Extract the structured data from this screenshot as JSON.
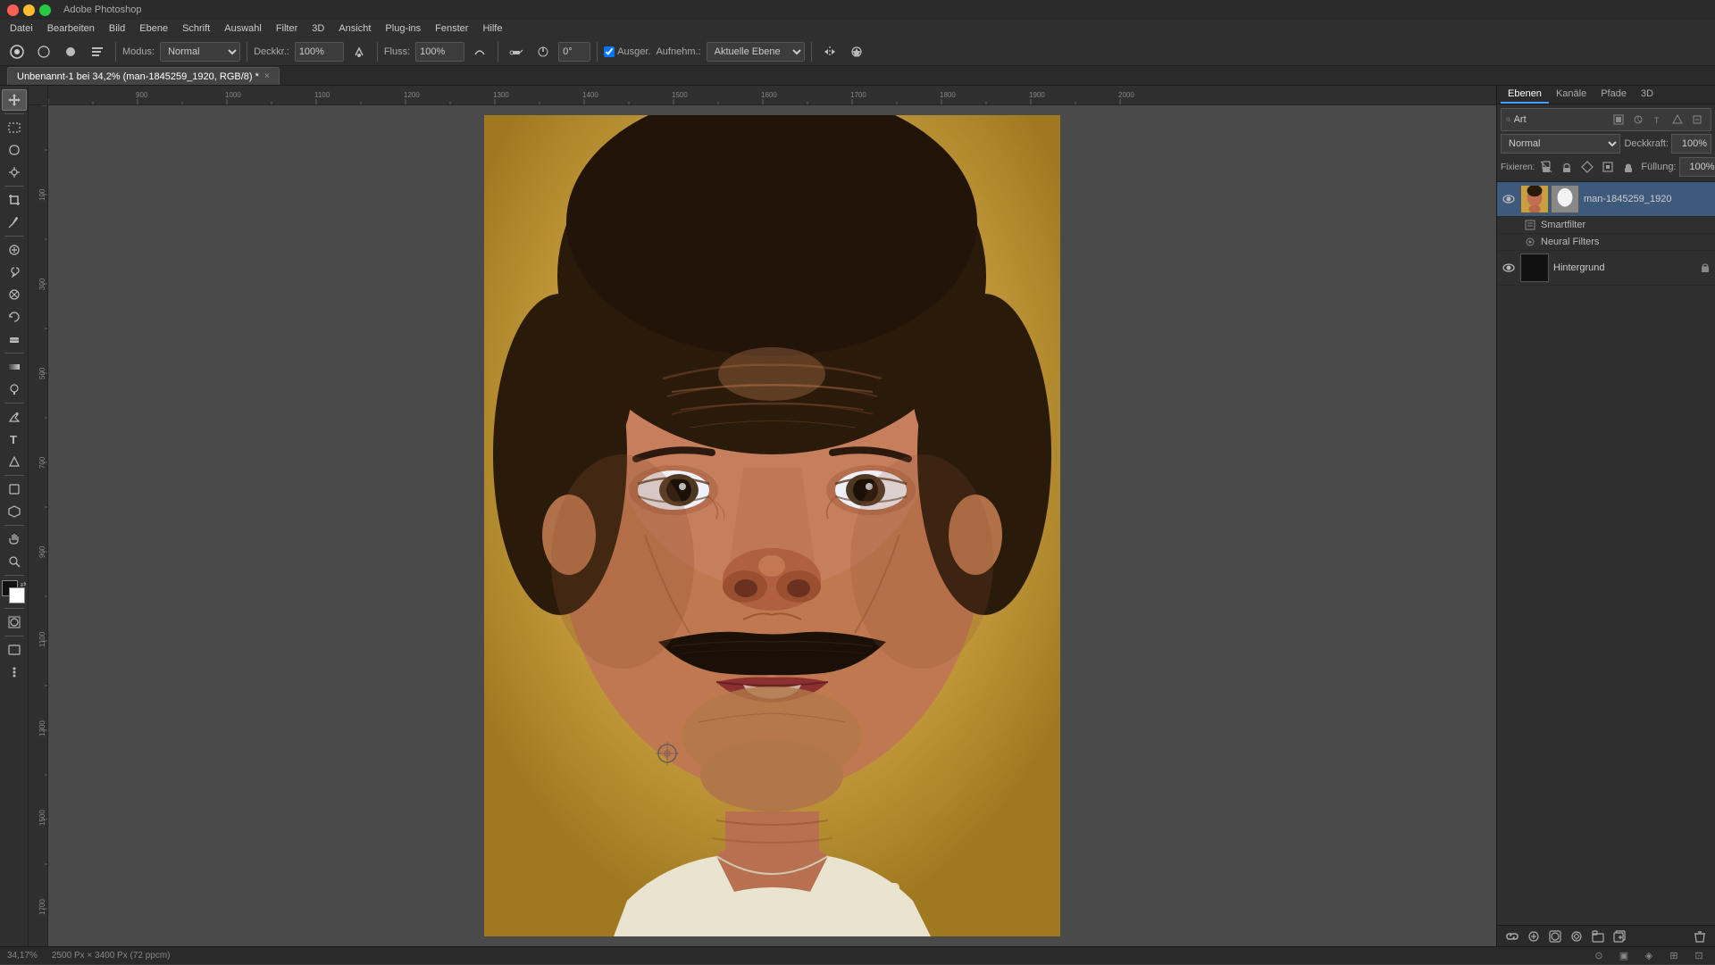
{
  "app": {
    "title": "Adobe Photoshop",
    "window_title": "Unbenannt-1 bei 34,2% (man-1845259_1920, RGB/8) *"
  },
  "titlebar": {
    "close_label": "×",
    "minimize_label": "−",
    "maximize_label": "□"
  },
  "menubar": {
    "items": [
      "Datei",
      "Bearbeiten",
      "Bild",
      "Ebene",
      "Schrift",
      "Auswahl",
      "Filter",
      "3D",
      "Ansicht",
      "Plug-ins",
      "Fenster",
      "Hilfe"
    ]
  },
  "toolbar": {
    "modus_label": "Modus:",
    "modus_value": "Normal",
    "deckel_label": "Deckkr.:",
    "deckel_value": "100%",
    "fluss_label": "Fluss:",
    "fluss_value": "100%",
    "winkel_value": "0°",
    "ausger_label": "Ausger.",
    "aufnehm_label": "Aufnehm.:",
    "aktuelle_ebene_label": "Aktuelle Ebene"
  },
  "tab": {
    "title": "Unbenannt-1 bei 34,2% (man-1845259_1920, RGB/8) *",
    "close": "×"
  },
  "layers_panel": {
    "tabs": [
      "Ebenen",
      "Kanäle",
      "Pfade",
      "3D"
    ],
    "blend_mode": "Normal",
    "deckkraft_label": "Deckkraft:",
    "deckkraft_value": "100%",
    "füllung_label": "Füllung:",
    "füllung_value": "100%",
    "layers": [
      {
        "id": "man-layer",
        "name": "man-1845259_1920",
        "visible": true,
        "locked": false,
        "has_mask": true,
        "active": true,
        "sublayers": [
          {
            "name": "Smartfilter",
            "icon": "smartfilter"
          },
          {
            "name": "Neural Filters",
            "icon": "neural"
          }
        ]
      },
      {
        "id": "hintergrund",
        "name": "Hintergrund",
        "visible": true,
        "locked": true,
        "has_mask": false,
        "active": false,
        "sublayers": []
      }
    ],
    "filter_label": "Art",
    "search_placeholder": "Art"
  },
  "statusbar": {
    "zoom": "34,17%",
    "dimensions": "2500 Px × 3400 Px (72 ppcm)"
  },
  "icons": {
    "eye": "👁",
    "lock": "🔒",
    "link": "🔗",
    "search": "🔍",
    "move": "✥",
    "select_rect": "▭",
    "lasso": "⌾",
    "magic_wand": "✱",
    "crop": "⊡",
    "eyedropper": "⚗",
    "healing": "⊕",
    "brush": "🖌",
    "clone": "⊗",
    "eraser": "◻",
    "gradient": "◈",
    "dodge": "◉",
    "pen": "✒",
    "type": "T",
    "path": "△",
    "shape": "⬟",
    "hand": "✋",
    "zoom_tool": "⊙",
    "fg_bg": "◧",
    "mask": "⊞",
    "new_layer": "⊕",
    "delete_layer": "🗑",
    "add_adjustment": "⊘",
    "filter": "≡",
    "visibility": "●"
  }
}
